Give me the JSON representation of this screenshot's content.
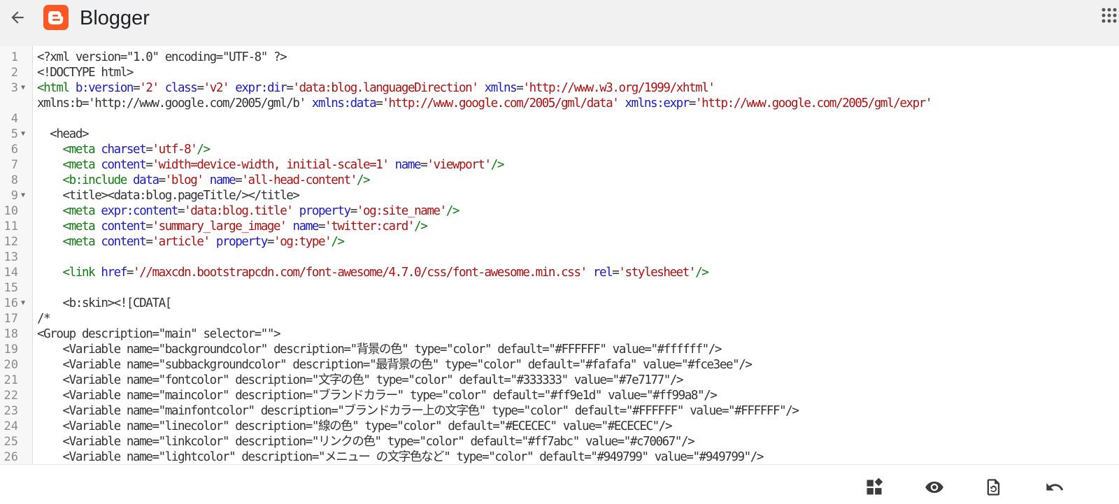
{
  "app": {
    "title": "Blogger"
  },
  "header": {
    "back_icon": "arrow-left-icon",
    "logo_icon": "blogger-logo-icon",
    "apps_icon": "grid-dots-icon",
    "brand_color": "#ff5722"
  },
  "code_lines": [
    {
      "no": "1",
      "fold": false,
      "text": "<?xml version=\"1.0\" encoding=\"UTF-8\" ?>"
    },
    {
      "no": "2",
      "fold": false,
      "text": "<!DOCTYPE html>"
    },
    {
      "no": "3",
      "fold": true,
      "text": "<html b:version='2' class='v2' expr:dir='data:blog.languageDirection' xmlns='http://www.w3.org/1999/xhtml'"
    },
    {
      "no": "",
      "fold": false,
      "text": "xmlns:b='http://www.google.com/2005/gml/b' xmlns:data='http://www.google.com/2005/gml/data' xmlns:expr='http://www.google.com/2005/gml/expr'"
    },
    {
      "no": "4",
      "fold": false,
      "text": ""
    },
    {
      "no": "5",
      "fold": true,
      "text": "  <head>"
    },
    {
      "no": "6",
      "fold": false,
      "text": "    <meta charset='utf-8'/>"
    },
    {
      "no": "7",
      "fold": false,
      "text": "    <meta content='width=device-width, initial-scale=1' name='viewport'/>"
    },
    {
      "no": "8",
      "fold": false,
      "text": "    <b:include data='blog' name='all-head-content'/>"
    },
    {
      "no": "9",
      "fold": true,
      "text": "    <title><data:blog.pageTitle/></title>"
    },
    {
      "no": "10",
      "fold": false,
      "text": "    <meta expr:content='data:blog.title' property='og:site_name'/>"
    },
    {
      "no": "11",
      "fold": false,
      "text": "    <meta content='summary_large_image' name='twitter:card'/>"
    },
    {
      "no": "12",
      "fold": false,
      "text": "    <meta content='article' property='og:type'/>"
    },
    {
      "no": "13",
      "fold": false,
      "text": ""
    },
    {
      "no": "14",
      "fold": false,
      "text": "    <link href='//maxcdn.bootstrapcdn.com/font-awesome/4.7.0/css/font-awesome.min.css' rel='stylesheet'/>"
    },
    {
      "no": "15",
      "fold": false,
      "text": ""
    },
    {
      "no": "16",
      "fold": true,
      "text": "    <b:skin><![CDATA["
    },
    {
      "no": "17",
      "fold": false,
      "text": "/*"
    },
    {
      "no": "18",
      "fold": false,
      "text": "<Group description=\"main\" selector=\"\">"
    },
    {
      "no": "19",
      "fold": false,
      "text": "    <Variable name=\"backgroundcolor\" description=\"背景の色\" type=\"color\" default=\"#FFFFFF\" value=\"#ffffff\"/>"
    },
    {
      "no": "20",
      "fold": false,
      "text": "    <Variable name=\"subbackgroundcolor\" description=\"最背景の色\" type=\"color\" default=\"#fafafa\" value=\"#fce3ee\"/>"
    },
    {
      "no": "21",
      "fold": false,
      "text": "    <Variable name=\"fontcolor\" description=\"文字の色\" type=\"color\" default=\"#333333\" value=\"#7e7177\"/>"
    },
    {
      "no": "22",
      "fold": false,
      "text": "    <Variable name=\"maincolor\" description=\"ブランドカラー\" type=\"color\" default=\"#ff9e1d\" value=\"#ff99a8\"/>"
    },
    {
      "no": "23",
      "fold": false,
      "text": "    <Variable name=\"mainfontcolor\" description=\"ブランドカラー上の文字色\" type=\"color\" default=\"#FFFFFF\" value=\"#FFFFFF\"/>"
    },
    {
      "no": "24",
      "fold": false,
      "text": "    <Variable name=\"linecolor\" description=\"線の色\" type=\"color\" default=\"#ECECEC\" value=\"#ECECEC\"/>"
    },
    {
      "no": "25",
      "fold": false,
      "text": "    <Variable name=\"linkcolor\" description=\"リンクの色\" type=\"color\" default=\"#ff7abc\" value=\"#c70067\"/>"
    },
    {
      "no": "26",
      "fold": false,
      "text": "    <Variable name=\"lightcolor\" description=\"メニュー の文字色など\" type=\"color\" default=\"#949799\" value=\"#949799\"/>"
    }
  ],
  "toolbar": {
    "items": [
      {
        "name": "jump-to-widget-button",
        "icon": "widget-grid-icon"
      },
      {
        "name": "preview-button",
        "icon": "eye-icon"
      },
      {
        "name": "restore-button",
        "icon": "restore-file-icon"
      },
      {
        "name": "undo-button",
        "icon": "undo-icon"
      }
    ]
  }
}
